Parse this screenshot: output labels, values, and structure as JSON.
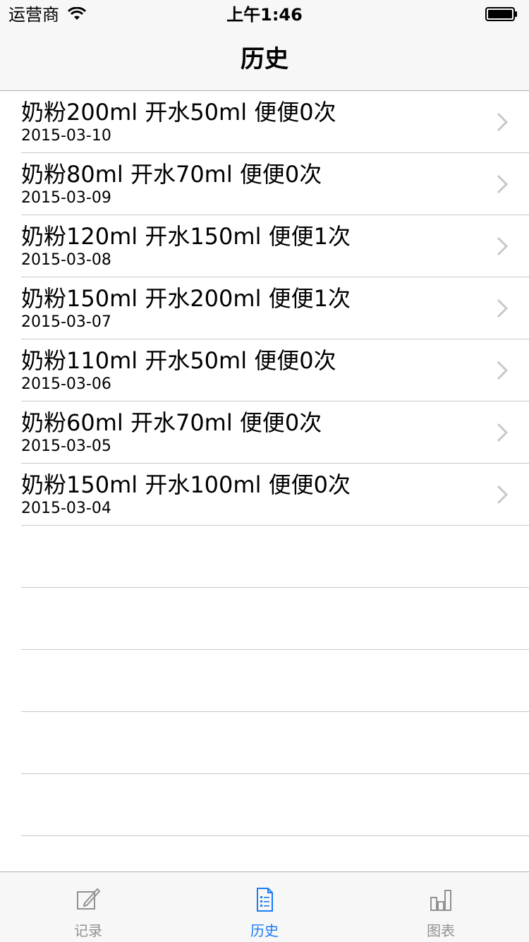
{
  "status_bar": {
    "carrier": "运营商",
    "time": "上午1:46"
  },
  "nav": {
    "title": "历史"
  },
  "history": [
    {
      "title": "奶粉200ml 开水50ml 便便0次",
      "date": "2015-03-10"
    },
    {
      "title": "奶粉80ml 开水70ml 便便0次",
      "date": "2015-03-09"
    },
    {
      "title": "奶粉120ml 开水150ml 便便1次",
      "date": "2015-03-08"
    },
    {
      "title": "奶粉150ml 开水200ml 便便1次",
      "date": "2015-03-07"
    },
    {
      "title": "奶粉110ml 开水50ml 便便0次",
      "date": "2015-03-06"
    },
    {
      "title": "奶粉60ml 开水70ml 便便0次",
      "date": "2015-03-05"
    },
    {
      "title": "奶粉150ml 开水100ml 便便0次",
      "date": "2015-03-04"
    }
  ],
  "tabs": [
    {
      "label": "记录",
      "icon": "compose-icon",
      "active": false
    },
    {
      "label": "历史",
      "icon": "list-icon",
      "active": true
    },
    {
      "label": "图表",
      "icon": "bar-chart-icon",
      "active": false
    }
  ],
  "colors": {
    "accent": "#1a7cf5",
    "inactive": "#929292",
    "separator": "#c8c7cc",
    "bar_bg": "#f7f7f7"
  }
}
